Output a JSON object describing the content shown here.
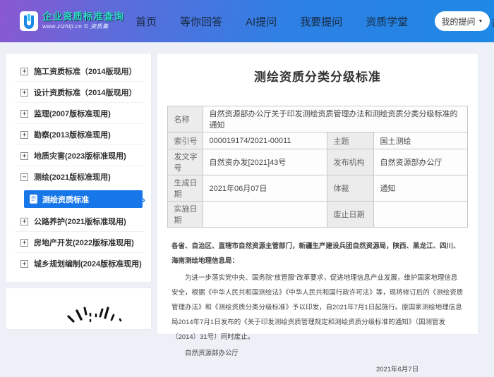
{
  "navbar": {
    "logo": {
      "title": "企业资质标准查询",
      "subtitle": "www.zizhiji.cn © 资质集"
    },
    "items": [
      "首页",
      "等你回答",
      "AI提问",
      "我要提问",
      "资质学堂"
    ],
    "my_questions_label": "我的提问",
    "partial_right_text": "请"
  },
  "icons": {
    "expand": "+",
    "collapse": "−",
    "caret": "▼",
    "chevron": "›"
  },
  "sidebar": {
    "items": [
      {
        "label": "施工资质标准（2014版现用）",
        "icon": "+"
      },
      {
        "label": "设计资质标准（2014版现用）",
        "icon": "+"
      },
      {
        "label": "监理(2007版标准现用)",
        "icon": "+"
      },
      {
        "label": "勘察(2013版标准现用)",
        "icon": "+"
      },
      {
        "label": "地质灾害(2023版标准现用)",
        "icon": "+"
      },
      {
        "label": "测绘(2021版标准现用)",
        "icon": "−"
      },
      {
        "label": "公路养护(2021版标准现用)",
        "icon": "+"
      },
      {
        "label": "房地产开发(2022版标准现用)",
        "icon": "+"
      },
      {
        "label": "城乡规划编制(2024版标准现用)",
        "icon": "+"
      }
    ],
    "active_child": {
      "label": "测绘资质标准"
    }
  },
  "main": {
    "title": "测绘资质分类分级标准",
    "info_table": {
      "r1": {
        "label": "名称",
        "value": "自然资源部办公厅关于印发测绘资质管理办法和测绘资质分类分级标准的通知"
      },
      "r2": {
        "label": "索引号",
        "value": "000019174/2021-00011",
        "label2": "主题",
        "value2": "国土测绘"
      },
      "r3": {
        "label": "发文字号",
        "value": "自然资办发[2021]43号",
        "label2": "发布机构",
        "value2": "自然资源部办公厅"
      },
      "r4": {
        "label": "生成日期",
        "value": "2021年06月07日",
        "label2": "体裁",
        "value2": "通知"
      },
      "r5": {
        "label": "实施日期",
        "value": "",
        "label2": "废止日期",
        "value2": ""
      }
    },
    "paragraphs": {
      "salutation": "各省、自治区、直辖市自然资源主管部门，新疆生产建设兵团自然资源局，陕西、黑龙江、四川、海南测绘地理信息局：",
      "body": "为进一步落实党中央、国务院“放管服”改革要求，促进地理信息产业发展，维护国家地理信息安全，根据《中华人民共和国测绘法》《中华人民共和国行政许可法》等，现将修订后的《测绘资质管理办法》和《测绘资质分类分级标准》予以印发，自2021年7月1日起施行。原国家测绘地理信息局2014年7月1日发布的《关于印发测绘资质管理规定和测绘资质分级标准的通知》（国测管发（2014）31号）同时废止。",
      "signature": "自然资源部办公厅",
      "date": "2021年6月7日"
    }
  },
  "colors": {
    "navbar_gradient_start": "#8a58d0",
    "navbar_gradient_end": "#1e88e5",
    "active_item_blue": "#1877e8",
    "logo_teal": "#2fe0c4",
    "table_label_bg": "#ececec",
    "page_bg": "#edf1f7"
  }
}
